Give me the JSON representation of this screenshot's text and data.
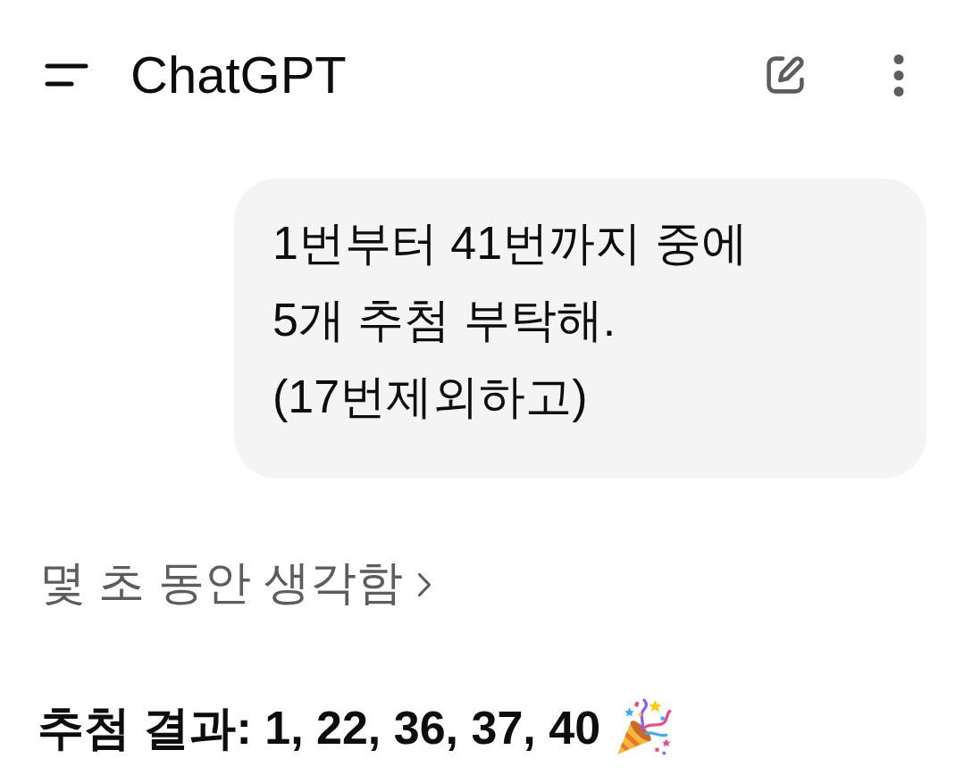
{
  "app_bar": {
    "title": "ChatGPT"
  },
  "conversation": [
    {
      "kind": "user",
      "text": "1번부터 41번까지 중에\n5개 추첨 부탁해.\n(17번제외하고)"
    },
    {
      "kind": "thinking",
      "label": "몇 초 동안 생각함",
      "expanded": false
    },
    {
      "kind": "assistant",
      "text": "추첨 결과: 1, 22, 36, 37, 40"
    }
  ]
}
